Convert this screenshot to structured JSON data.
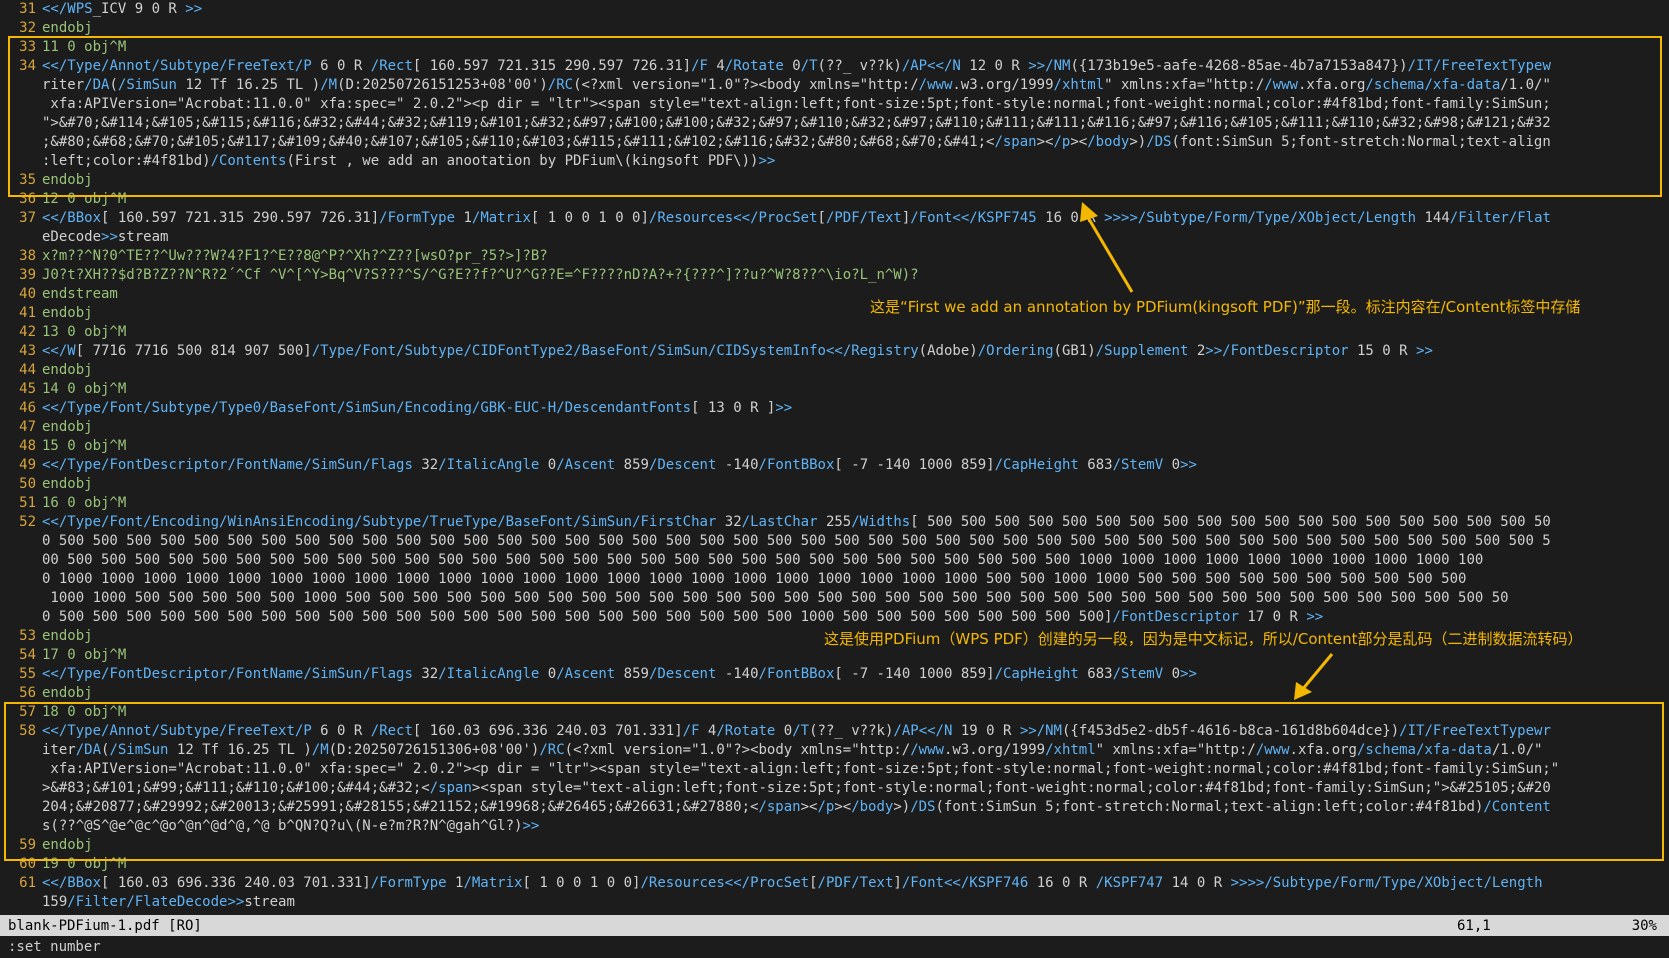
{
  "editor": {
    "lines": [
      {
        "n": "31",
        "text": "<</WPS_ICV 9 0 R >>"
      },
      {
        "n": "32",
        "text": "endobj"
      },
      {
        "n": "33",
        "text": "11 0 obj^M"
      },
      {
        "n": "34",
        "text": "<</Type/Annot/Subtype/FreeText/P 6 0 R /Rect[ 160.597 721.315 290.597 726.31]/F 4/Rotate 0/T(??_ v??k)/AP<</N 12 0 R >>/NM({173b19e5-aafe-4268-85ae-4b7a7153a847})/IT/FreeTextTypew"
      },
      {
        "n": "",
        "text": "riter/DA(/SimSun 12 Tf 16.25 TL )/M(D:20250726151253+08'00')/RC(<?xml version=\"1.0\"?><body xmlns=\"http://www.w3.org/1999/xhtml\" xmlns:xfa=\"http://www.xfa.org/schema/xfa-data/1.0/\""
      },
      {
        "n": "",
        "text": " xfa:APIVersion=\"Acrobat:11.0.0\" xfa:spec=\" 2.0.2\"><p dir = \"ltr\"><span style=\"text-align:left;font-size:5pt;font-style:normal;font-weight:normal;color:#4f81bd;font-family:SimSun;"
      },
      {
        "n": "",
        "text": "\">&#70;&#114;&#105;&#115;&#116;&#32;&#44;&#32;&#119;&#101;&#32;&#97;&#100;&#100;&#32;&#97;&#110;&#32;&#97;&#110;&#111;&#111;&#116;&#97;&#116;&#105;&#111;&#110;&#32;&#98;&#121;&#32"
      },
      {
        "n": "",
        "text": ";&#80;&#68;&#70;&#105;&#117;&#109;&#40;&#107;&#105;&#110;&#103;&#115;&#111;&#102;&#116;&#32;&#80;&#68;&#70;&#41;</span></p></body>)/DS(font:SimSun 5;font-stretch:Normal;text-align"
      },
      {
        "n": "",
        "text": ":left;color:#4f81bd)/Contents(First , we add an anootation by PDFium\\(kingsoft PDF\\))>>"
      },
      {
        "n": "35",
        "text": "endobj"
      },
      {
        "n": "36",
        "text": "12 0 obj^M"
      },
      {
        "n": "37",
        "text": "<</BBox[ 160.597 721.315 290.597 726.31]/FormType 1/Matrix[ 1 0 0 1 0 0]/Resources<</ProcSet[/PDF/Text]/Font<</KSPF745 16 0 R >>>>/Subtype/Form/Type/XObject/Length 144/Filter/Flat"
      },
      {
        "n": "",
        "text": "eDecode>>stream"
      },
      {
        "n": "38",
        "text": "x?m??^N?0^TE??^Uw???W?4?F1?^E??8@^P?^Xh?^Z??[wsO?pr_?5?>]?B?"
      },
      {
        "n": "39",
        "text": "J0?t?XH??$d?B?Z??N^R?2´^Cf ^V^[^Y>Bq^V?S???^S/^G?E??f?^U?^G??E=^F????nD?A?+?{???^]??u?^W?8??^\\io?L_n^W)?"
      },
      {
        "n": "40",
        "text": "endstream"
      },
      {
        "n": "41",
        "text": "endobj"
      },
      {
        "n": "42",
        "text": "13 0 obj^M"
      },
      {
        "n": "43",
        "text": "<</W[ 7716 7716 500 814 907 500]/Type/Font/Subtype/CIDFontType2/BaseFont/SimSun/CIDSystemInfo<</Registry(Adobe)/Ordering(GB1)/Supplement 2>>/FontDescriptor 15 0 R >>"
      },
      {
        "n": "44",
        "text": "endobj"
      },
      {
        "n": "45",
        "text": "14 0 obj^M"
      },
      {
        "n": "46",
        "text": "<</Type/Font/Subtype/Type0/BaseFont/SimSun/Encoding/GBK-EUC-H/DescendantFonts[ 13 0 R ]>>"
      },
      {
        "n": "47",
        "text": "endobj"
      },
      {
        "n": "48",
        "text": "15 0 obj^M"
      },
      {
        "n": "49",
        "text": "<</Type/FontDescriptor/FontName/SimSun/Flags 32/ItalicAngle 0/Ascent 859/Descent -140/FontBBox[ -7 -140 1000 859]/CapHeight 683/StemV 0>>"
      },
      {
        "n": "50",
        "text": "endobj"
      },
      {
        "n": "51",
        "text": "16 0 obj^M"
      },
      {
        "n": "52",
        "text": "<</Type/Font/Encoding/WinAnsiEncoding/Subtype/TrueType/BaseFont/SimSun/FirstChar 32/LastChar 255/Widths[ 500 500 500 500 500 500 500 500 500 500 500 500 500 500 500 500 500 500 50"
      },
      {
        "n": "",
        "text": "0 500 500 500 500 500 500 500 500 500 500 500 500 500 500 500 500 500 500 500 500 500 500 500 500 500 500 500 500 500 500 500 500 500 500 500 500 500 500 500 500 500 500 500 500 5"
      },
      {
        "n": "",
        "text": "00 500 500 500 500 500 500 500 500 500 500 500 500 500 500 500 500 500 500 500 500 500 500 500 500 500 500 500 500 500 500 1000 1000 1000 1000 1000 1000 1000 1000 1000 100"
      },
      {
        "n": "",
        "text": "0 1000 1000 1000 1000 1000 1000 1000 1000 1000 1000 1000 1000 1000 1000 1000 1000 1000 1000 1000 1000 1000 1000 500 500 1000 1000 500 500 500 500 500 500 500 500 500 500"
      },
      {
        "n": "",
        "text": " 1000 1000 500 500 500 500 500 1000 500 500 500 500 500 500 500 500 500 500 500 500 500 500 500 500 500 500 500 500 500 500 500 500 500 500 500 500 500 500 500 500 500 500 50"
      },
      {
        "n": "",
        "text": "0 500 500 500 500 500 500 500 500 500 500 500 500 500 500 500 500 500 500 500 500 500 500 1000 500 500 500 500 500 500 500 500]/FontDescriptor 17 0 R >>"
      },
      {
        "n": "53",
        "text": "endobj"
      },
      {
        "n": "54",
        "text": "17 0 obj^M"
      },
      {
        "n": "55",
        "text": "<</Type/FontDescriptor/FontName/SimSun/Flags 32/ItalicAngle 0/Ascent 859/Descent -140/FontBBox[ -7 -140 1000 859]/CapHeight 683/StemV 0>>"
      },
      {
        "n": "56",
        "text": "endobj"
      },
      {
        "n": "57",
        "text": "18 0 obj^M"
      },
      {
        "n": "58",
        "text": "<</Type/Annot/Subtype/FreeText/P 6 0 R /Rect[ 160.03 696.336 240.03 701.331]/F 4/Rotate 0/T(??_ v??k)/AP<</N 19 0 R >>/NM({f453d5e2-db5f-4616-b8ca-161d8b604dce})/IT/FreeTextTypewr"
      },
      {
        "n": "",
        "text": "iter/DA(/SimSun 12 Tf 16.25 TL )/M(D:20250726151306+08'00')/RC(<?xml version=\"1.0\"?><body xmlns=\"http://www.w3.org/1999/xhtml\" xmlns:xfa=\"http://www.xfa.org/schema/xfa-data/1.0/\""
      },
      {
        "n": "",
        "text": " xfa:APIVersion=\"Acrobat:11.0.0\" xfa:spec=\" 2.0.2\"><p dir = \"ltr\"><span style=\"text-align:left;font-size:5pt;font-style:normal;font-weight:normal;color:#4f81bd;font-family:SimSun;\""
      },
      {
        "n": "",
        "text": ">&#83;&#101;&#99;&#111;&#110;&#100;&#44;&#32;</span><span style=\"text-align:left;font-size:5pt;font-style:normal;font-weight:normal;color:#4f81bd;font-family:SimSun;\">&#25105;&#20"
      },
      {
        "n": "",
        "text": "204;&#20877;&#29992;&#20013;&#25991;&#28155;&#21152;&#19968;&#26465;&#26631;&#27880;</span></p></body>)/DS(font:SimSun 5;font-stretch:Normal;text-align:left;color:#4f81bd)/Content"
      },
      {
        "n": "",
        "text": "s(??^@S^@e^@c^@o^@n^@d^@,^@ b^QN?Q?u\\(N-e?m?R?N^@gah^Gl?)>>"
      },
      {
        "n": "59",
        "text": "endobj"
      },
      {
        "n": "60",
        "text": "19 0 obj^M"
      },
      {
        "n": "61",
        "text": "<</BBox[ 160.03 696.336 240.03 701.331]/FormType 1/Matrix[ 1 0 0 1 0 0]/Resources<</ProcSet[/PDF/Text]/Font<</KSPF746 16 0 R /KSPF747 14 0 R >>>>/Subtype/Form/Type/XObject/Length"
      },
      {
        "n": "",
        "text": "159/Filter/FlateDecode>>stream"
      }
    ]
  },
  "annotations": {
    "note1": "这是“First we add an annotation by PDFium(kingsoft PDF)”那一段。标注内容在/Content标签中存储",
    "note2": "这是使用PDFium（WPS PDF）创建的另一段，因为是中文标记，所以/Content部分是乱码（二进制数据流转码）"
  },
  "statusbar": {
    "filename": "blank-PDFium-1.pdf [RO]",
    "position": "61,1",
    "percent": "30%"
  },
  "cmdline": ":set number",
  "colors": {
    "highlight": "#f5b800",
    "line_number": "#d7a53b",
    "keyword": "#5fb3f5",
    "number": "#c678dd"
  }
}
